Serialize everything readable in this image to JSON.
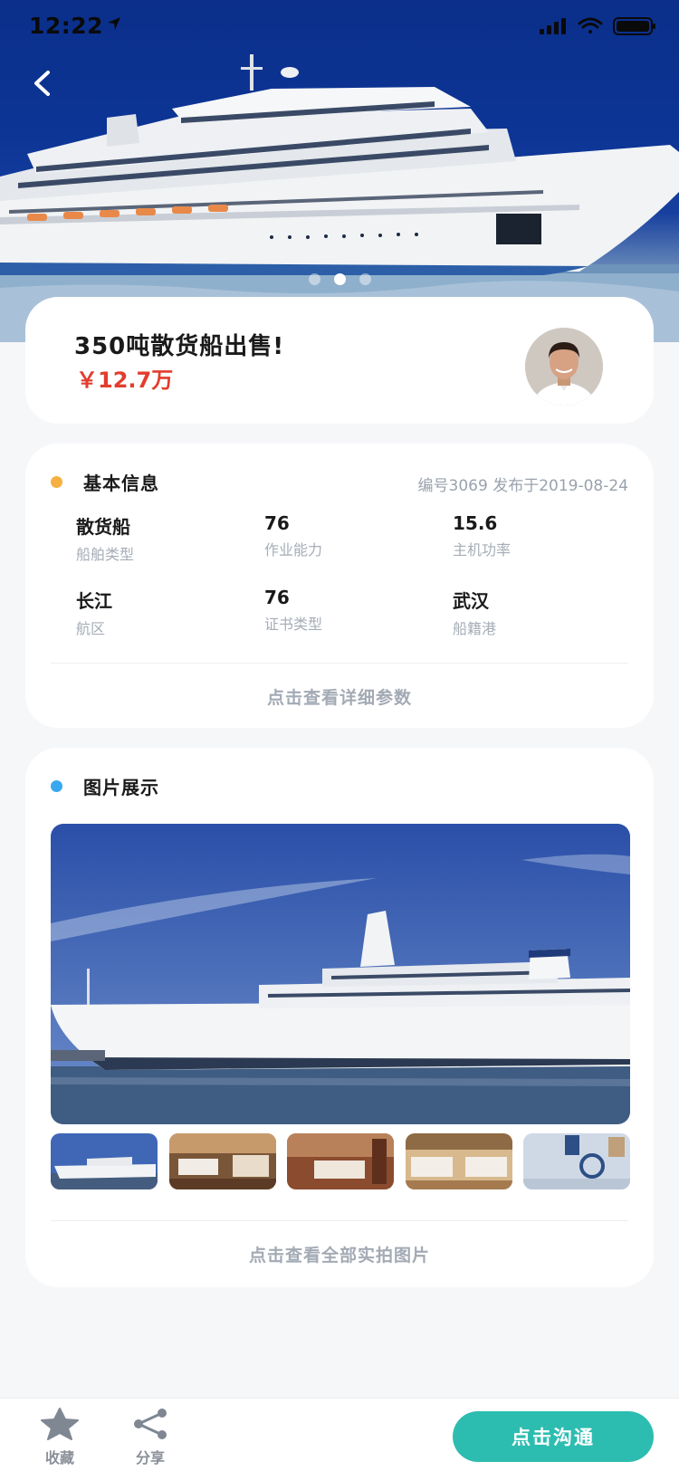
{
  "status_bar": {
    "time": "12:22"
  },
  "hero": {
    "carousel_count": 3,
    "active_index": 1
  },
  "listing": {
    "title": "350吨散货船出售!",
    "price": "￥12.7万"
  },
  "basic_info": {
    "title": "基本信息",
    "meta": "编号3069 发布于2019-08-24",
    "fields": [
      {
        "value": "散货船",
        "label": "船舶类型"
      },
      {
        "value": "76",
        "label": "作业能力"
      },
      {
        "value": "15.6",
        "label": "主机功率"
      },
      {
        "value": "长江",
        "label": "航区"
      },
      {
        "value": "76",
        "label": "证书类型"
      },
      {
        "value": "武汉",
        "label": "船籍港"
      }
    ],
    "more_link": "点击查看详细参数"
  },
  "photos": {
    "title": "图片展示",
    "thumb_count": 5,
    "more_link": "点击查看全部实拍图片"
  },
  "bottom_bar": {
    "favorite_label": "收藏",
    "share_label": "分享",
    "chat_button": "点击沟通"
  },
  "colors": {
    "price": "#e23d2e",
    "accent_teal": "#2dbdb0",
    "dot_orange": "#f5b041",
    "dot_blue": "#3aa8f0"
  },
  "icons": [
    "back-icon",
    "location-arrow-icon",
    "signal-icon",
    "wifi-icon",
    "battery-icon",
    "star-icon",
    "share-icon"
  ]
}
